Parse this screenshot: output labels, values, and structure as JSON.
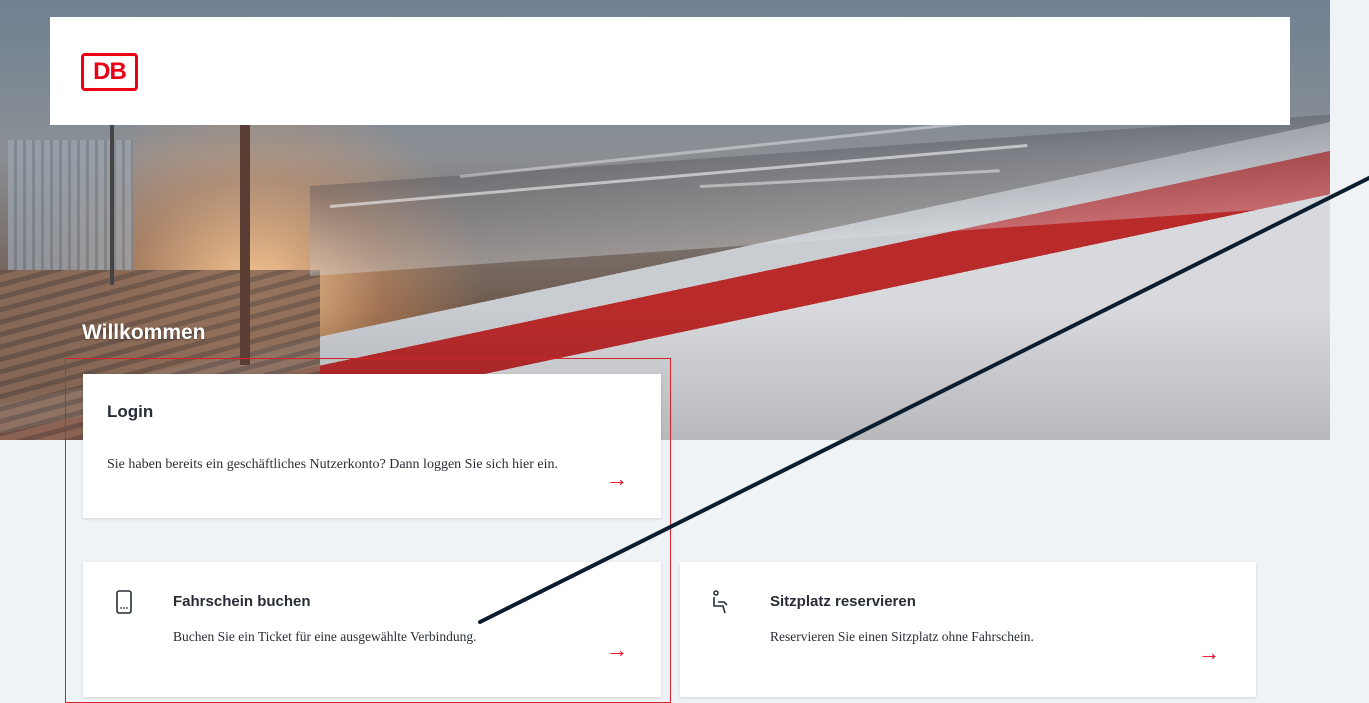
{
  "header": {
    "logo_text": "DB"
  },
  "hero": {
    "welcome": "Willkommen"
  },
  "login": {
    "title": "Login",
    "description": "Sie haben bereits ein geschäftliches Nutzerkonto? Dann loggen Sie sich hier ein.",
    "arrow": "→"
  },
  "cards": [
    {
      "icon": "smartphone-icon",
      "title": "Fahrschein buchen",
      "description": "Buchen Sie ein Ticket für eine ausgewählte Verbindung.",
      "arrow": "→"
    },
    {
      "icon": "seat-icon",
      "title": "Sitzplatz reservieren",
      "description": "Reservieren Sie einen Sitzplatz ohne Fahrschein.",
      "arrow": "→"
    }
  ],
  "colors": {
    "brand_red": "#ec0016",
    "background": "#f0f3f5",
    "annotation_frame": "#d4232b",
    "annotation_line": "#0c1e2e"
  }
}
